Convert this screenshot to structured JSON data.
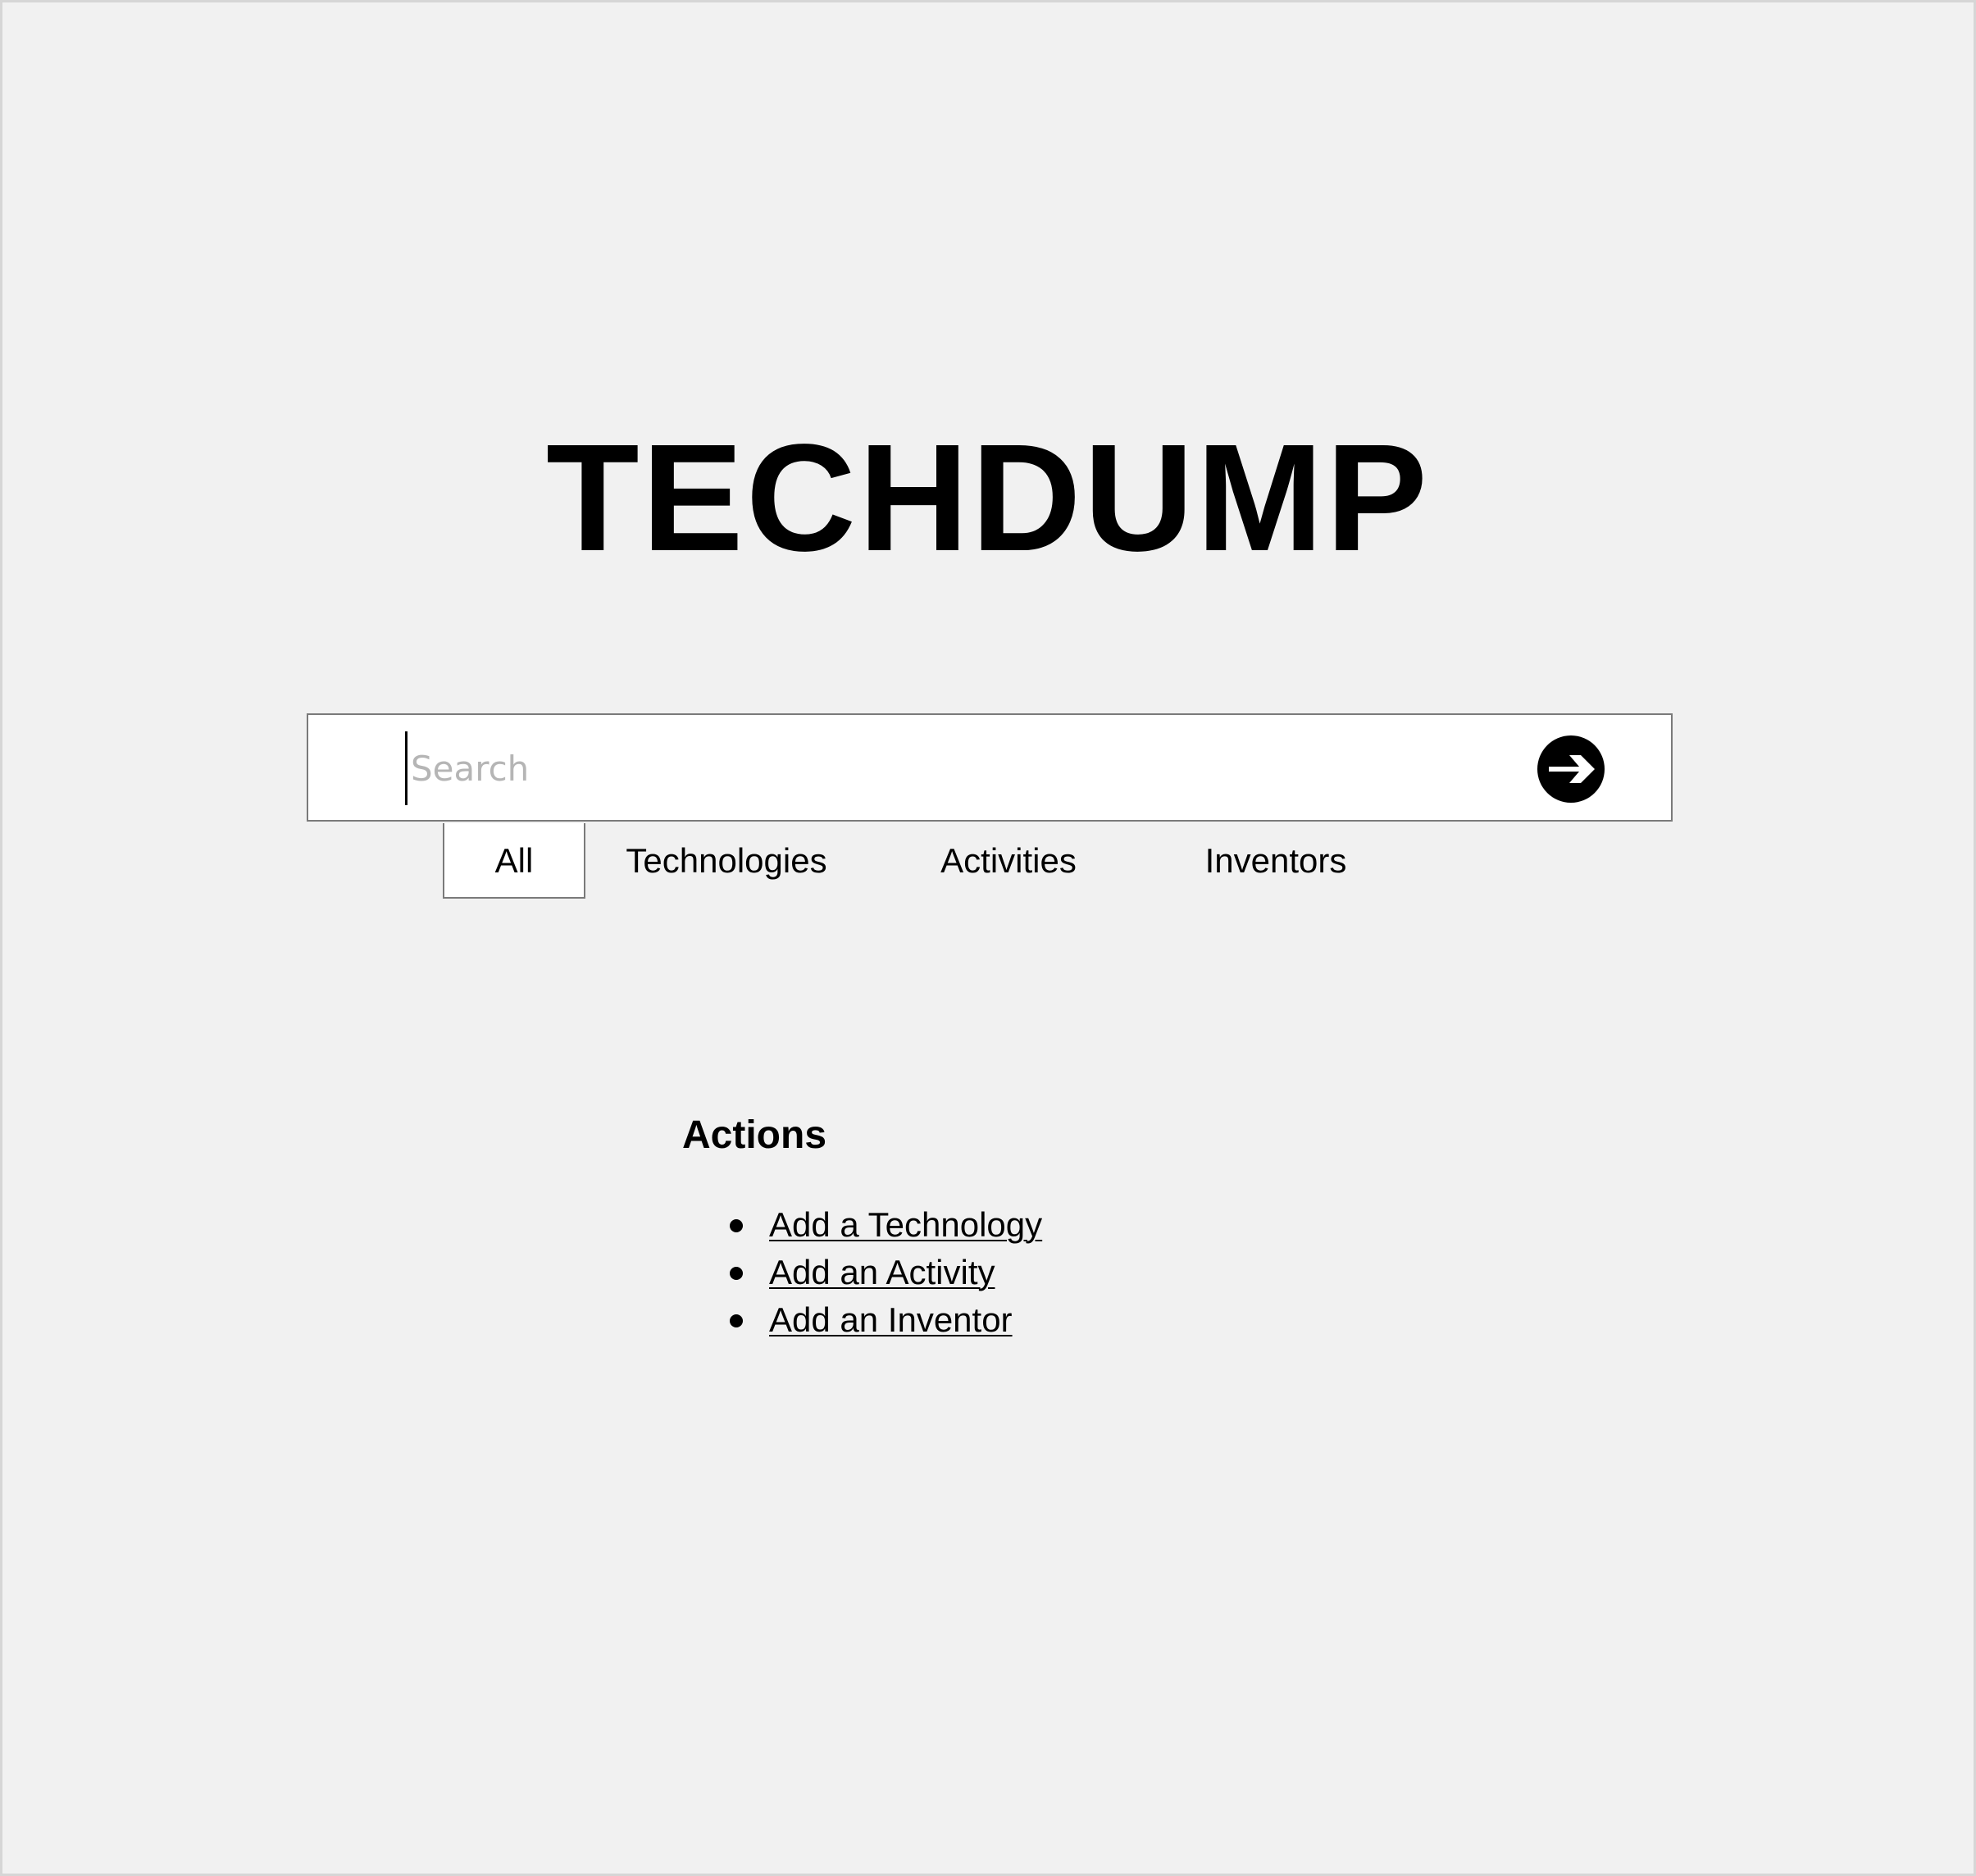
{
  "site": {
    "logo_text": "TECHDUMP"
  },
  "search": {
    "placeholder": "Search",
    "value": "",
    "submit_icon": "arrow-right-circle-icon"
  },
  "tabs": [
    {
      "label": "All",
      "active": true
    },
    {
      "label": "Technologies",
      "active": false
    },
    {
      "label": "Activities",
      "active": false
    },
    {
      "label": "Inventors",
      "active": false
    }
  ],
  "actions": {
    "title": "Actions",
    "items": [
      {
        "label": "Add a Technology"
      },
      {
        "label": "Add an Activity"
      },
      {
        "label": "Add an Inventor"
      }
    ]
  },
  "colors": {
    "background": "#f1f1f1",
    "panel": "#ffffff",
    "border": "#7a7a7a",
    "text": "#000000",
    "placeholder": "#b5b5b5"
  }
}
